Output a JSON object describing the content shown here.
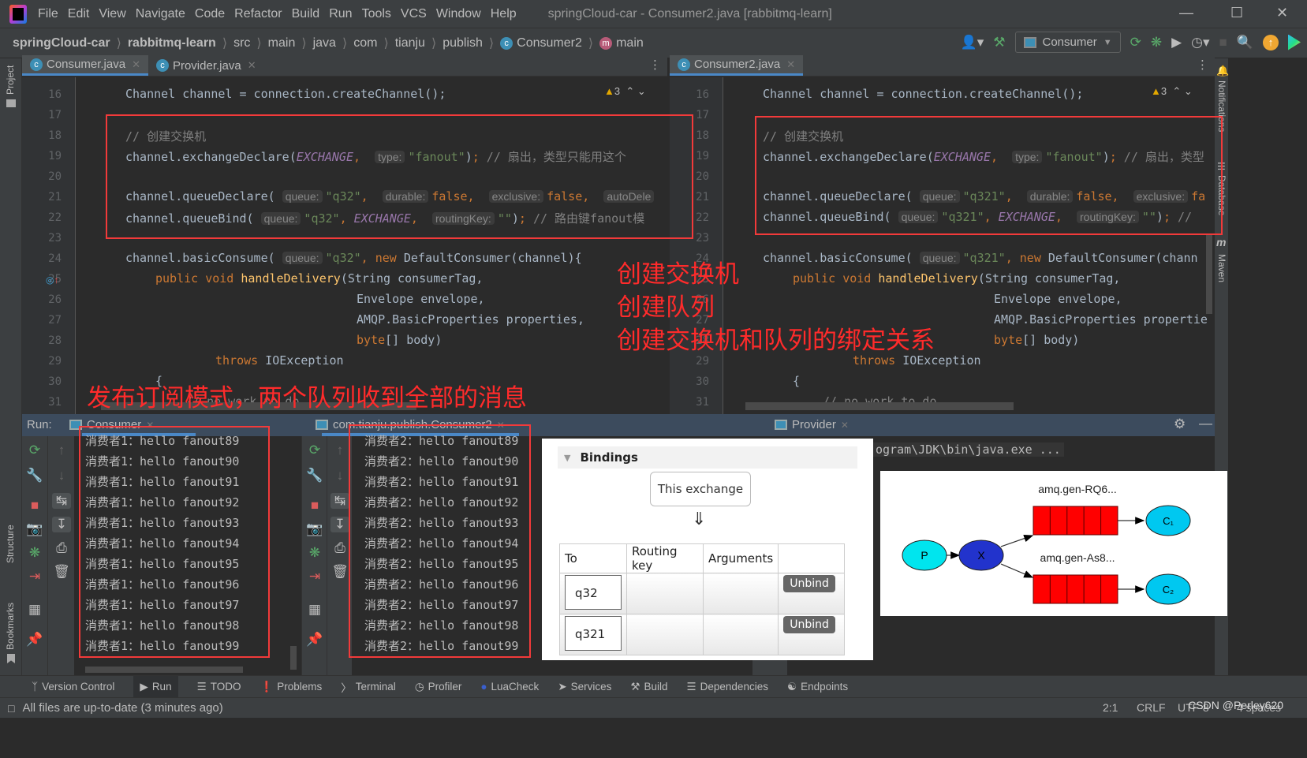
{
  "window": {
    "title": "springCloud-car - Consumer2.java [rabbitmq-learn]",
    "menu": [
      "File",
      "Edit",
      "View",
      "Navigate",
      "Code",
      "Refactor",
      "Build",
      "Run",
      "Tools",
      "VCS",
      "Window",
      "Help"
    ]
  },
  "breadcrumb": [
    "springCloud-car",
    "rabbitmq-learn",
    "src",
    "main",
    "java",
    "com",
    "tianju",
    "publish",
    "Consumer2",
    "main"
  ],
  "toolbar": {
    "run_config": "Consumer"
  },
  "side_tools": {
    "left": [
      "Project",
      "Structure",
      "Bookmarks"
    ],
    "right": [
      "Notifications",
      "Database",
      "Maven"
    ]
  },
  "editor_left": {
    "tabs": [
      {
        "label": "Consumer.java",
        "active": true
      },
      {
        "label": "Provider.java",
        "active": false
      }
    ],
    "warnings": "3",
    "lines": [
      "16",
      "17",
      "18",
      "19",
      "20",
      "21",
      "22",
      "23",
      "24",
      "25",
      "26",
      "27",
      "28",
      "29",
      "30",
      "31"
    ],
    "code": {
      "l16": "Channel channel = connection.createChannel();",
      "l18": "// 创建交换机",
      "l19_a": "channel.exchangeDeclare(",
      "l19_const": "EXCHANGE",
      "l19_hint": "type:",
      "l19_str": "\"fanout\"",
      "l19_cm": "// 扇出，类型只能用这个",
      "l21_a": "channel.queueDeclare(",
      "l21_hint1": "queue:",
      "l21_str": "\"q32\"",
      "l21_hint2": "durable:",
      "l21_v2": "false",
      "l21_hint3": "exclusive:",
      "l21_v3": "false",
      "l21_hint4": "autoDele",
      "l22_a": "channel.queueBind(",
      "l22_hint1": "queue:",
      "l22_str": "\"q32\"",
      "l22_const": "EXCHANGE",
      "l22_hint2": "routingKey:",
      "l22_str2": "\"\"",
      "l22_cm": "// 路由键fanout模",
      "l24_a": "channel.basicConsume(",
      "l24_hint": "queue:",
      "l24_str": "\"q32\"",
      "l24_new": "new",
      "l24_b": "DefaultConsumer(channel){",
      "l25_kw": "public void",
      "l25_fn": "handleDelivery",
      "l25_b": "(String consumerTag,",
      "l26": "Envelope envelope,",
      "l27": "AMQP.BasicProperties properties,",
      "l28_kw": "byte",
      "l28_b": "[] body)",
      "l29_kw": "throws",
      "l29_b": "IOException",
      "l30": "{",
      "l31": "// no work to do"
    }
  },
  "editor_right": {
    "tabs": [
      {
        "label": "Consumer2.java",
        "active": true
      }
    ],
    "warnings": "3",
    "lines": [
      "16",
      "17",
      "18",
      "19",
      "20",
      "21",
      "22",
      "23",
      "24",
      "25",
      "26",
      "27",
      "28",
      "29",
      "30",
      "31"
    ],
    "code": {
      "l16": "Channel channel = connection.createChannel();",
      "l18": "// 创建交换机",
      "l19_a": "channel.exchangeDeclare(",
      "l19_const": "EXCHANGE",
      "l19_hint": "type:",
      "l19_str": "\"fanout\"",
      "l19_cm": "// 扇出，类型",
      "l21_a": "channel.queueDeclare(",
      "l21_hint1": "queue:",
      "l21_str": "\"q321\"",
      "l21_hint2": "durable:",
      "l21_v2": "false",
      "l21_hint3": "exclusive:",
      "l21_v3": "fa",
      "l22_a": "channel.queueBind(",
      "l22_hint1": "queue:",
      "l22_str": "\"q321\"",
      "l22_const": "EXCHANGE",
      "l22_hint2": "routingKey:",
      "l22_str2": "\"\"",
      "l22_cm": "//",
      "l24_a": "channel.basicConsume(",
      "l24_hint": "queue:",
      "l24_str": "\"q321\"",
      "l24_new": "new",
      "l24_b": "DefaultConsumer(chann",
      "l25_kw": "public void",
      "l25_fn": "handleDelivery",
      "l25_b": "(String consumerTag,",
      "l26": "Envelope envelope,",
      "l27": "AMQP.BasicProperties propertie",
      "l28_kw": "byte",
      "l28_b": "[] body)",
      "l29_kw": "throws",
      "l29_b": "IOException",
      "l30": "{",
      "l31": "// no work to do"
    }
  },
  "annotations": {
    "steps": [
      "创建交换机",
      "创建队列",
      "创建交换机和队列的绑定关系"
    ],
    "summary": "发布订阅模式，两个队列收到全部的消息"
  },
  "run_panel": {
    "label": "Run:",
    "tabs": [
      {
        "label": "Consumer"
      },
      {
        "label": "com.tianju.publish.Consumer2"
      },
      {
        "label": "Provider"
      }
    ],
    "consumer1_lines": [
      "消费者1：hello fanout89",
      "消费者1：hello fanout90",
      "消费者1：hello fanout91",
      "消费者1：hello fanout92",
      "消费者1：hello fanout93",
      "消费者1：hello fanout94",
      "消费者1：hello fanout95",
      "消费者1：hello fanout96",
      "消费者1：hello fanout97",
      "消费者1：hello fanout98",
      "消费者1：hello fanout99"
    ],
    "consumer2_lines": [
      "消费者2：hello fanout89",
      "消费者2：hello fanout90",
      "消费者2：hello fanout91",
      "消费者2：hello fanout92",
      "消费者2：hello fanout93",
      "消费者2：hello fanout94",
      "消费者2：hello fanout95",
      "消费者2：hello fanout96",
      "消费者2：hello fanout97",
      "消费者2：hello fanout98",
      "消费者2：hello fanout99"
    ],
    "provider_line": "ogram\\JDK\\bin\\java.exe ..."
  },
  "bindings": {
    "title": "Bindings",
    "source": "This exchange",
    "arrow": "⇓",
    "columns": [
      "To",
      "Routing key",
      "Arguments",
      ""
    ],
    "rows": [
      {
        "to": "q32",
        "routing_key": "",
        "arguments": "",
        "action": "Unbind"
      },
      {
        "to": "q321",
        "routing_key": "",
        "arguments": "",
        "action": "Unbind"
      }
    ]
  },
  "diagram": {
    "producer": "P",
    "exchange": "X",
    "queues": [
      "amq.gen-RQ6...",
      "amq.gen-As8..."
    ],
    "consumers": [
      "C₁",
      "C₂"
    ],
    "colors": {
      "producer": "#00e5ee",
      "exchange": "#2233cc",
      "queue": "#ff0000",
      "consumer": "#00c8f0"
    }
  },
  "bottom_tools": [
    "Version Control",
    "Run",
    "TODO",
    "Problems",
    "Terminal",
    "Profiler",
    "LuaCheck",
    "Services",
    "Build",
    "Dependencies",
    "Endpoints"
  ],
  "status": {
    "message": "All files are up-to-date (3 minutes ago)",
    "position": "2:1",
    "line_sep": "CRLF",
    "encoding": "UTF-8",
    "indent": "4 spaces",
    "watermark": "CSDN @Perley620"
  }
}
